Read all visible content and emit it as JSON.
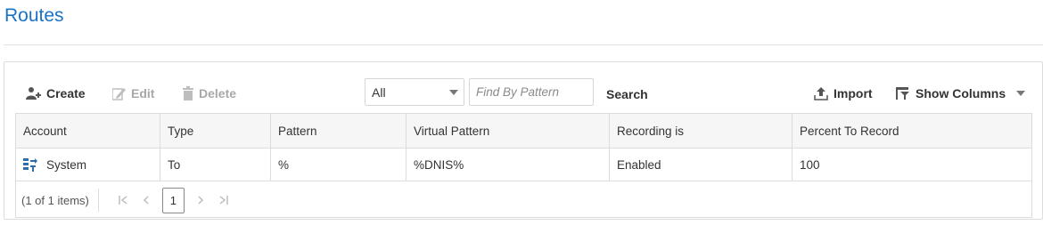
{
  "page": {
    "title": "Routes"
  },
  "toolbar": {
    "create_label": "Create",
    "edit_label": "Edit",
    "delete_label": "Delete",
    "filter_selected": "All",
    "search_placeholder": "Find By Pattern",
    "search_label": "Search",
    "import_label": "Import",
    "show_columns_label": "Show Columns"
  },
  "table": {
    "columns": [
      "Account",
      "Type",
      "Pattern",
      "Virtual Pattern",
      "Recording is",
      "Percent To Record"
    ],
    "rows": [
      {
        "account": "System",
        "type": "To",
        "pattern": "%",
        "virtual_pattern": "%DNIS%",
        "recording": "Enabled",
        "percent": "100"
      }
    ]
  },
  "pager": {
    "summary": "(1 of 1 items)",
    "current_page": "1"
  },
  "colors": {
    "accent": "#1a73c4",
    "border": "#dcdcdc",
    "disabled": "#a8a8a8"
  }
}
